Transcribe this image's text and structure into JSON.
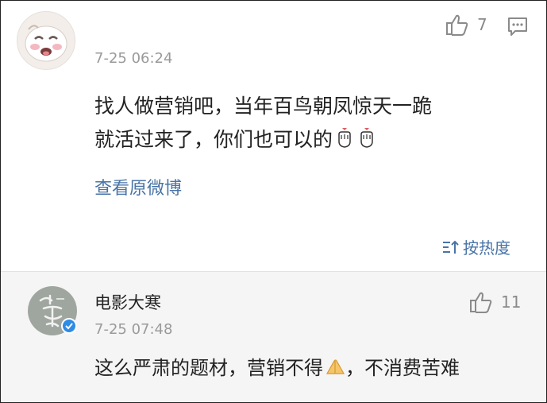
{
  "comment": {
    "time": "7-25 06:24",
    "like_count": "7",
    "text_line1": "找人做营销吧，当年百鸟朝凤惊天一跪",
    "text_line2": "就活过来了，你们也可以的",
    "view_original": "查看原微博"
  },
  "sort": {
    "label": "按热度"
  },
  "reply": {
    "username": "电影大寒",
    "time": "7-25 07:48",
    "like_count": "11",
    "text_a": "这么严肃的题材，营销不得",
    "text_b": "，不消费苦难"
  },
  "icons": {
    "like": "thumbs-up-icon",
    "comment": "comment-icon",
    "sort": "sort-icon",
    "emoji_heart_hands": "heart-hands-emoji-icon",
    "emoji_pray": "pray-hands-emoji-icon",
    "verified": "verified-badge-icon"
  },
  "colors": {
    "link": "#4a74a6",
    "reply_bg": "#f5f5f5",
    "verified": "#2e8be6"
  }
}
